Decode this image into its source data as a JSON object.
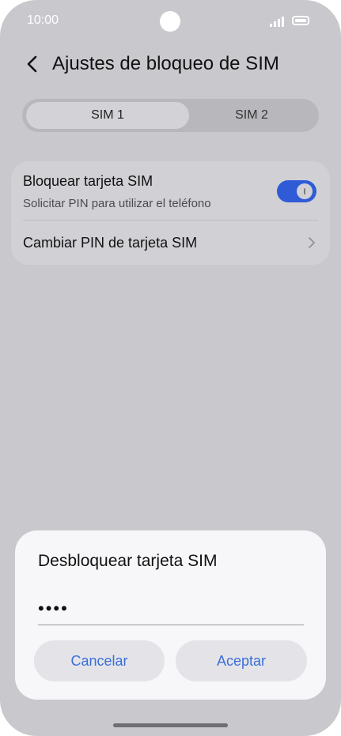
{
  "status_bar": {
    "time": "10:00"
  },
  "header": {
    "title": "Ajustes de bloqueo de SIM"
  },
  "sim_tabs": [
    {
      "label": "SIM 1",
      "selected": true
    },
    {
      "label": "SIM 2",
      "selected": false
    }
  ],
  "settings": {
    "lock_sim": {
      "title": "Bloquear tarjeta SIM",
      "subtitle": "Solicitar PIN para utilizar el teléfono",
      "enabled": true
    },
    "change_pin": {
      "title": "Cambiar PIN de tarjeta SIM"
    }
  },
  "dialog": {
    "title": "Desbloquear tarjeta SIM",
    "pin_value": "••••",
    "cancel_label": "Cancelar",
    "accept_label": "Aceptar"
  },
  "colors": {
    "accent": "#2f5bd6",
    "dialog_button_text": "#3b6fd8"
  },
  "icons": [
    "back-arrow-icon",
    "chevron-right-icon",
    "signal-icon",
    "battery-icon"
  ]
}
